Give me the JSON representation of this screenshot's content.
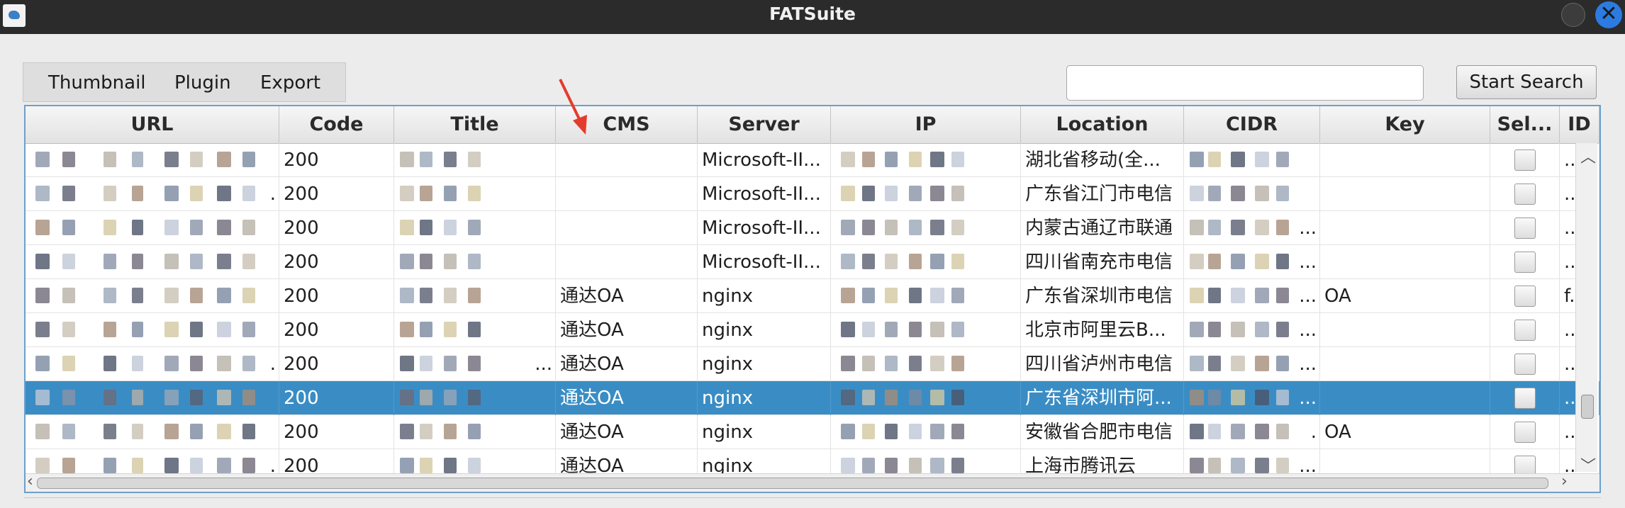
{
  "window": {
    "title": "FATSuite"
  },
  "menu": {
    "thumbnail": "Thumbnail",
    "plugin": "Plugin",
    "export": "Export"
  },
  "search": {
    "value": "",
    "button_label": "Start Search"
  },
  "table": {
    "columns": [
      "URL",
      "Code",
      "Title",
      "CMS",
      "Server",
      "IP",
      "Location",
      "CIDR",
      "Key",
      "Sel...",
      "ID"
    ],
    "rows": [
      {
        "url": "",
        "code": "200",
        "title": "",
        "cms": "",
        "server": "Microsoft-II...",
        "ip": "",
        "location": "湖北省移动(全...",
        "cidr": "",
        "key": "",
        "id": "..."
      },
      {
        "url": ".",
        "code": "200",
        "title": "",
        "cms": "",
        "server": "Microsoft-II...",
        "ip": "",
        "location": "广东省江门市电信",
        "cidr": "",
        "key": "",
        "id": "..."
      },
      {
        "url": "",
        "code": "200",
        "title": "",
        "cms": "",
        "server": "Microsoft-II...",
        "ip": "",
        "location": "内蒙古通辽市联通",
        "cidr": "...",
        "key": "",
        "id": "..."
      },
      {
        "url": "",
        "code": "200",
        "title": "",
        "cms": "",
        "server": "Microsoft-II...",
        "ip": "",
        "location": "四川省南充市电信",
        "cidr": "...",
        "key": "",
        "id": "..."
      },
      {
        "url": "",
        "code": "200",
        "title": "",
        "cms": "通达OA",
        "server": "nginx",
        "ip": "",
        "location": "广东省深圳市电信",
        "cidr": "...",
        "key": "OA",
        "id": "f..."
      },
      {
        "url": "",
        "code": "200",
        "title": "",
        "cms": "通达OA",
        "server": "nginx",
        "ip": "",
        "location": "北京市阿里云B...",
        "cidr": "...",
        "key": "",
        "id": "..."
      },
      {
        "url": ".",
        "code": "200",
        "title": "...",
        "cms": "通达OA",
        "server": "nginx",
        "ip": "",
        "location": "四川省泸州市电信",
        "cidr": "...",
        "key": "",
        "id": "..."
      },
      {
        "url": "",
        "code": "200",
        "title": "",
        "cms": "通达OA",
        "server": "nginx",
        "ip": "",
        "location": "广东省深圳市阿...",
        "cidr": "...",
        "key": "",
        "id": "..."
      },
      {
        "url": "",
        "code": "200",
        "title": "",
        "cms": "通达OA",
        "server": "nginx",
        "ip": "",
        "location": "安徽省合肥市电信",
        "cidr": ".",
        "key": "OA",
        "id": "..."
      },
      {
        "url": ".",
        "code": "200",
        "title": "",
        "cms": "通达OA",
        "server": "nginx",
        "ip": "",
        "location": "上海市腾讯云",
        "cidr": "...",
        "key": "",
        "id": "..."
      }
    ],
    "selected_row": 8
  },
  "colors": {
    "selection": "#3a8dc4",
    "annotation_arrow": "#e53b2c",
    "titlebar": "#2b2b2b"
  }
}
